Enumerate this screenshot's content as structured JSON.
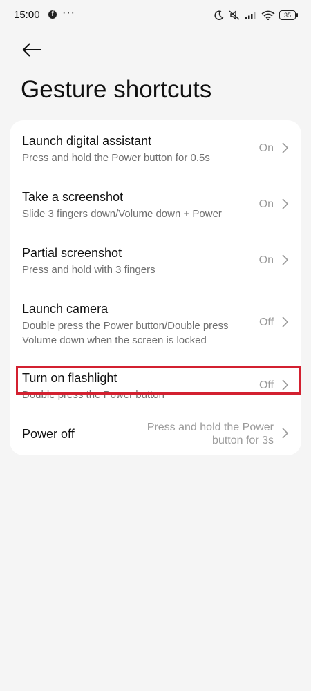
{
  "status_bar": {
    "time": "15:00",
    "notifications": [
      "facebook-icon",
      "more-dots"
    ],
    "more_dots": "···",
    "facebook_glyph": "f",
    "battery": "35",
    "icons": [
      "moon-icon",
      "mute-icon",
      "signal-icon",
      "wifi-icon",
      "battery-icon"
    ]
  },
  "header": {
    "back_icon": "arrow-left-icon",
    "title": "Gesture shortcuts"
  },
  "items": [
    {
      "title": "Launch digital assistant",
      "subtitle": "Press and hold the Power button for 0.5s",
      "value": "On"
    },
    {
      "title": "Take a screenshot",
      "subtitle": "Slide 3 fingers down/Volume down + Power",
      "value": "On"
    },
    {
      "title": "Partial screenshot",
      "subtitle": "Press and hold with 3 fingers",
      "value": "On"
    },
    {
      "title": "Launch camera",
      "subtitle": "Double press the Power button/Double press Volume down when the screen is locked",
      "value": "Off"
    },
    {
      "title": "Turn on flashlight",
      "subtitle": "Double press the Power button",
      "value": "Off"
    },
    {
      "title": "Power off",
      "subtitle": "",
      "value": "Press and hold the Power button for 3s"
    }
  ],
  "highlighted_item": "Turn on flashlight",
  "colors": {
    "background": "#f5f5f5",
    "card": "#ffffff",
    "highlight": "#d32030"
  }
}
